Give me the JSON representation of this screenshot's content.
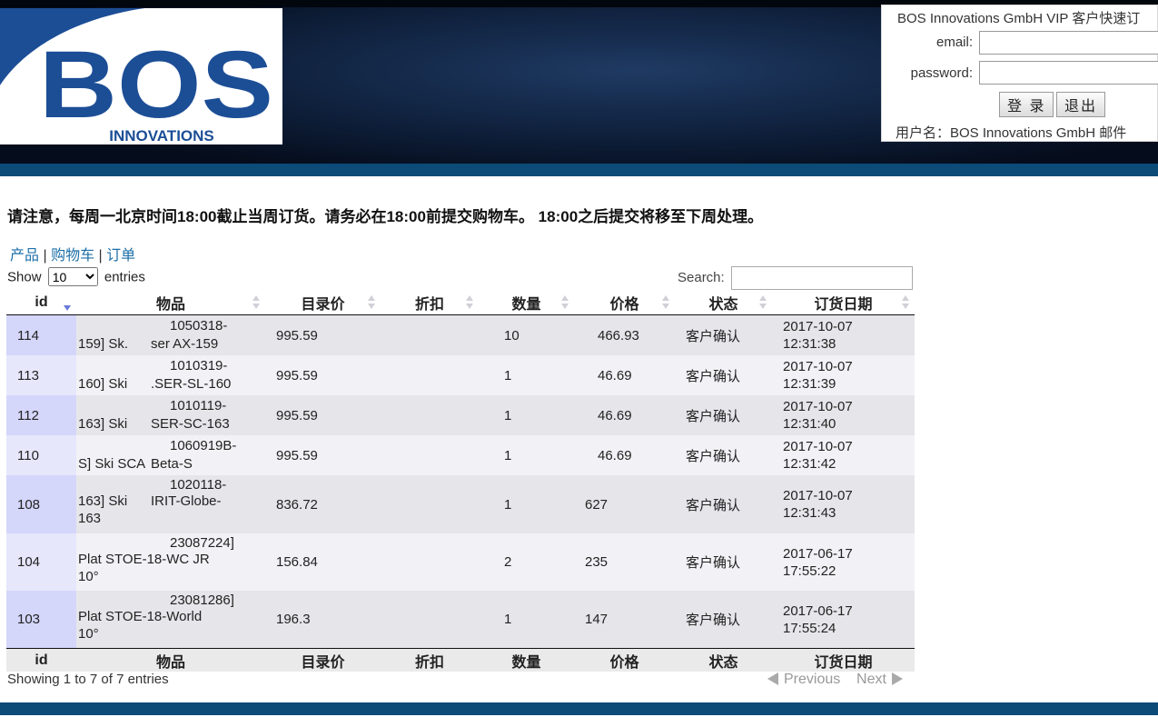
{
  "brand": {
    "logo_text": "BOS",
    "logo_subtext": "INNOVATIONS",
    "colors": {
      "logo_blue": "#1c4e96",
      "header_dark": "#06101f",
      "stripe_blue": "#0c4a78"
    }
  },
  "login": {
    "title": "BOS Innovations GmbH VIP 客户快速订",
    "email_label": "email:",
    "email_value": "",
    "password_label": "password:",
    "password_value": "",
    "login_button": "登 录",
    "logout_button": "退出",
    "user_line": "用户名：BOS Innovations GmbH    邮件"
  },
  "notice": "请注意，每周一北京时间18:00截止当周订货。请务必在18:00前提交购物车。 18:00之后提交将移至下周处理。",
  "nav": {
    "products": "产品",
    "cart": "购物车",
    "orders": "订单",
    "separator": "|"
  },
  "table_controls": {
    "show_label": "Show",
    "entries_label": "entries",
    "page_length": "10",
    "search_label": "Search:",
    "search_value": ""
  },
  "columns": [
    "id",
    "物品",
    "目录价",
    "折扣",
    "数量",
    "价格",
    "状态",
    "订货日期"
  ],
  "rows": [
    {
      "id": "114",
      "item_l1": "1050318-",
      "item_l2a": "159] Sk.",
      "item_l2b": "ser AX-159",
      "item_l3": "",
      "list_price": "995.59",
      "discount": "",
      "qty": "10",
      "price": "466.93",
      "status": "客户确认",
      "date": "2017-10-07",
      "time": "12:31:38"
    },
    {
      "id": "113",
      "item_l1": "1010319-",
      "item_l2a": "160] Ski",
      "item_l2b": ".SER-SL-160",
      "item_l3": "",
      "list_price": "995.59",
      "discount": "",
      "qty": "1",
      "price": "46.69",
      "status": "客户确认",
      "date": "2017-10-07",
      "time": "12:31:39"
    },
    {
      "id": "112",
      "item_l1": "1010119-",
      "item_l2a": "163] Ski",
      "item_l2b": "SER-SC-163",
      "item_l3": "",
      "list_price": "995.59",
      "discount": "",
      "qty": "1",
      "price": "46.69",
      "status": "客户确认",
      "date": "2017-10-07",
      "time": "12:31:40"
    },
    {
      "id": "110",
      "item_l1": "1060919B-",
      "item_l2a": "S] Ski SCA",
      "item_l2b": "Beta-S",
      "item_l3": "",
      "list_price": "995.59",
      "discount": "",
      "qty": "1",
      "price": "46.69",
      "status": "客户确认",
      "date": "2017-10-07",
      "time": "12:31:42"
    },
    {
      "id": "108",
      "item_l1": "1020118-",
      "item_l2a": "163] Ski",
      "item_l2b": "IRIT-Globe-",
      "item_l3": "163",
      "list_price": "836.72",
      "discount": "",
      "qty": "1",
      "price": "627",
      "status": "客户确认",
      "date": "2017-10-07",
      "time": "12:31:43"
    },
    {
      "id": "104",
      "item_l1": "23087224]",
      "item_l2a": "Plat STOE-18-WC JR",
      "item_l2b": "",
      "item_l3": "10°",
      "list_price": "156.84",
      "discount": "",
      "qty": "2",
      "price": "235",
      "status": "客户确认",
      "date": "2017-06-17",
      "time": "17:55:22"
    },
    {
      "id": "103",
      "item_l1": "23081286]",
      "item_l2a": "Plat STOE-18-World",
      "item_l2b": "",
      "item_l3": "10°",
      "list_price": "196.3",
      "discount": "",
      "qty": "1",
      "price": "147",
      "status": "客户确认",
      "date": "2017-06-17",
      "time": "17:55:24"
    }
  ],
  "footer": {
    "info": "Showing 1 to 7 of 7 entries",
    "previous": "Previous",
    "next": "Next"
  }
}
